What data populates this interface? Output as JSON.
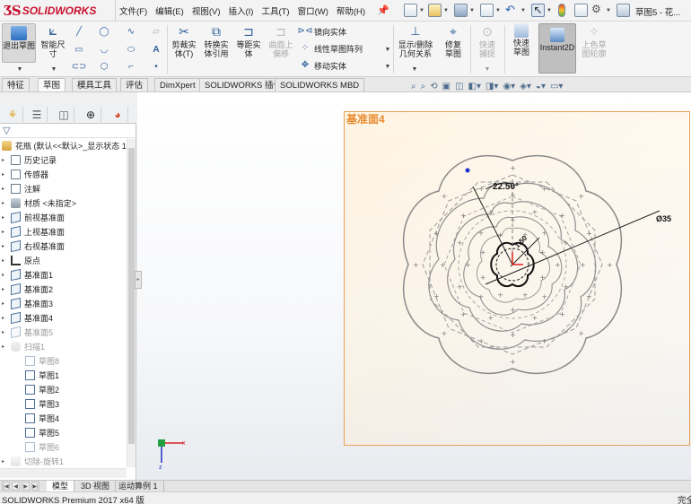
{
  "app": {
    "logo_text": "SOLIDWORKS",
    "document_title": "草图5 - 花..."
  },
  "menu": [
    "文件(F)",
    "编辑(E)",
    "视图(V)",
    "插入(I)",
    "工具(T)",
    "窗口(W)",
    "帮助(H)"
  ],
  "command_manager": {
    "exit_sketch": "退出草图",
    "smart_dimension": "智能尺寸",
    "trim_entities": "剪裁实体(T)",
    "convert_entities": "转换实体引用",
    "offset_entities": "等距实体",
    "offset_on_surface": "曲面上偏移",
    "mirror_entities": "镜向实体",
    "linear_pattern": "线性草图阵列",
    "move_entities": "移动实体",
    "display_delete_relations": "显示/删除几何关系",
    "repair_sketch": "修复草图",
    "quick_snaps": "快速捕捉",
    "rapid_sketch": "快速草图",
    "instant2d": "Instant2D",
    "shaded_sketch_contours": "上色草图轮廓"
  },
  "tabs": [
    "特征",
    "草图",
    "模具工具",
    "评估",
    "DimXpert",
    "SOLIDWORKS 插件",
    "SOLIDWORKS MBD"
  ],
  "active_tab": "草图",
  "feature_tree": {
    "root": "花瓶  (默认<<默认>_显示状态 1",
    "items": [
      {
        "label": "历史记录",
        "icon": "history-icon",
        "gray": false
      },
      {
        "label": "传感器",
        "icon": "sensor-icon",
        "gray": false
      },
      {
        "label": "注解",
        "icon": "annotation-icon",
        "gray": false
      },
      {
        "label": "材质 <未指定>",
        "icon": "material-icon",
        "gray": false
      },
      {
        "label": "前视基准面",
        "icon": "plane-icon",
        "gray": false
      },
      {
        "label": "上视基准面",
        "icon": "plane-icon",
        "gray": false
      },
      {
        "label": "右视基准面",
        "icon": "plane-icon",
        "gray": false
      },
      {
        "label": "原点",
        "icon": "origin-icon",
        "gray": false
      },
      {
        "label": "基准面1",
        "icon": "plane-icon",
        "gray": false
      },
      {
        "label": "基准面2",
        "icon": "plane-icon",
        "gray": false
      },
      {
        "label": "基准面3",
        "icon": "plane-icon",
        "gray": false
      },
      {
        "label": "基准面4",
        "icon": "plane-icon",
        "gray": false
      },
      {
        "label": "基准面5",
        "icon": "plane-icon",
        "gray": true
      },
      {
        "label": "扫描1",
        "icon": "sweep-icon",
        "gray": true
      },
      {
        "label": "草图8",
        "icon": "sketch-icon",
        "gray": true
      },
      {
        "label": "草图1",
        "icon": "sketch-icon",
        "gray": false
      },
      {
        "label": "草图2",
        "icon": "sketch-icon",
        "gray": false
      },
      {
        "label": "草图3",
        "icon": "sketch-icon",
        "gray": false
      },
      {
        "label": "草图4",
        "icon": "sketch-icon",
        "gray": false
      },
      {
        "label": "草图5",
        "icon": "sketch-icon",
        "gray": false
      },
      {
        "label": "草图6",
        "icon": "sketch-icon",
        "gray": true
      },
      {
        "label": "切除-旋转1",
        "icon": "cut-icon",
        "gray": true
      }
    ]
  },
  "graphics": {
    "plane_label": "基准面4",
    "dim_angle": "22.50°",
    "dim_diameter": "Ø35",
    "dim_small": "1.50"
  },
  "bottom_tabs": [
    "模型",
    "3D 视图",
    "运动算例 1"
  ],
  "status": {
    "left": "SOLIDWORKS Premium 2017 x64 版",
    "right": "完全"
  }
}
